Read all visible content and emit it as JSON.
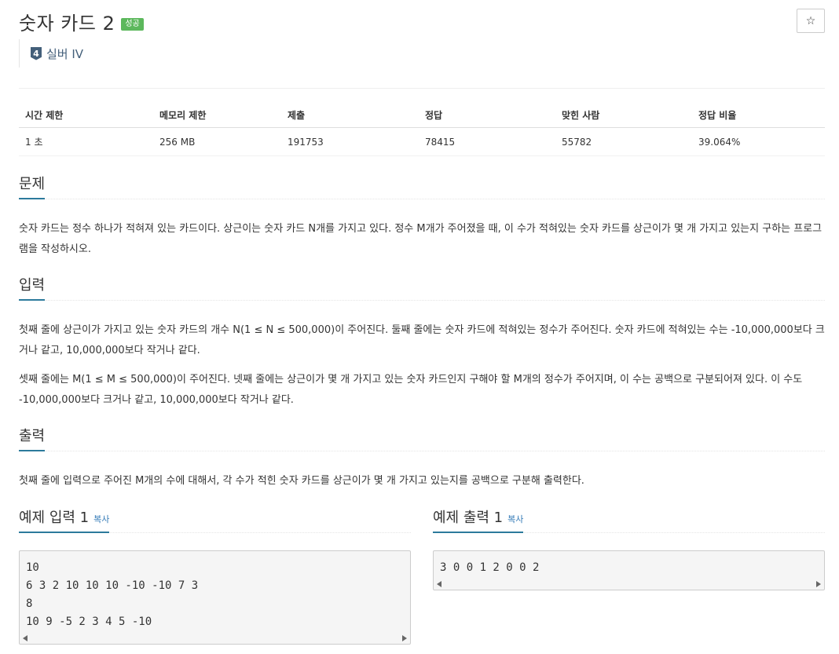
{
  "problem": {
    "title": "숫자 카드 2",
    "status_badge": "성공",
    "star_glyph": "☆",
    "tier_number": "4",
    "tier_label": "실버 IV"
  },
  "info_table": {
    "headers": [
      "시간 제한",
      "메모리 제한",
      "제출",
      "정답",
      "맞힌 사람",
      "정답 비율"
    ],
    "values": [
      "1 초",
      "256 MB",
      "191753",
      "78415",
      "55782",
      "39.064%"
    ]
  },
  "sections": {
    "description": {
      "heading": "문제",
      "paragraphs": [
        "숫자 카드는 정수 하나가 적혀져 있는 카드이다. 상근이는 숫자 카드 N개를 가지고 있다. 정수 M개가 주어졌을 때, 이 수가 적혀있는 숫자 카드를 상근이가 몇 개 가지고 있는지 구하는 프로그램을 작성하시오."
      ]
    },
    "input": {
      "heading": "입력",
      "paragraphs": [
        "첫째 줄에 상근이가 가지고 있는 숫자 카드의 개수 N(1 ≤ N ≤ 500,000)이 주어진다. 둘째 줄에는 숫자 카드에 적혀있는 정수가 주어진다. 숫자 카드에 적혀있는 수는 -10,000,000보다 크거나 같고, 10,000,000보다 작거나 같다.",
        "셋째 줄에는 M(1 ≤ M ≤ 500,000)이 주어진다. 넷째 줄에는 상근이가 몇 개 가지고 있는 숫자 카드인지 구해야 할 M개의 정수가 주어지며, 이 수는 공백으로 구분되어져 있다. 이 수도 -10,000,000보다 크거나 같고, 10,000,000보다 작거나 같다."
      ]
    },
    "output": {
      "heading": "출력",
      "paragraphs": [
        "첫째 줄에 입력으로 주어진 M개의 수에 대해서, 각 수가 적힌 숫자 카드를 상근이가 몇 개 가지고 있는지를 공백으로 구분해 출력한다."
      ]
    }
  },
  "samples": {
    "input": {
      "heading": "예제 입력 1",
      "copy_label": "복사",
      "text": "10\n6 3 2 10 10 10 -10 -10 7 3\n8\n10 9 -5 2 3 4 5 -10"
    },
    "output": {
      "heading": "예제 출력 1",
      "copy_label": "복사",
      "text": "3 0 0 1 2 0 0 2"
    }
  },
  "colors": {
    "badge_green": "#5cb85c",
    "section_underline": "#2c7a9c",
    "link_blue": "#337ab7",
    "tier_silver": "#435f7a"
  }
}
